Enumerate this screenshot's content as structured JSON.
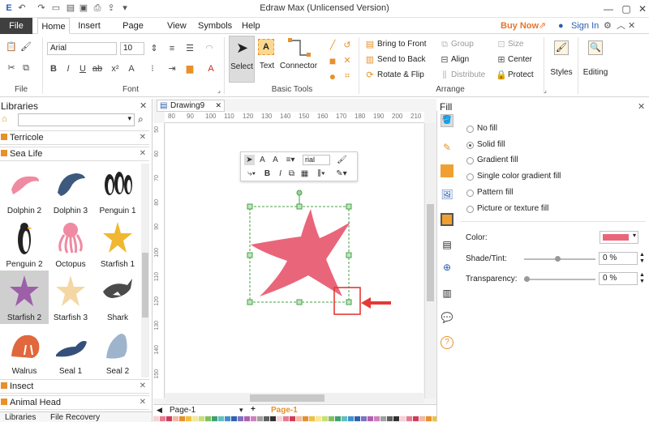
{
  "window": {
    "title": "Edraw Max (Unlicensed Version)"
  },
  "titlebar_right": {
    "buy_now": "Buy Now",
    "sign_in": "Sign In"
  },
  "tabs": [
    "File",
    "Home",
    "Insert",
    "Page Layout",
    "View",
    "Symbols",
    "Help"
  ],
  "ribbon": {
    "file_label": "File",
    "font_label": "Font",
    "font_name": "Arial",
    "font_size": "10",
    "basic_tools_label": "Basic Tools",
    "select": "Select",
    "text": "Text",
    "connector": "Connector",
    "bring_to_front": "Bring to Front",
    "send_to_back": "Send to Back",
    "rotate_flip": "Rotate & Flip",
    "group": "Group",
    "align": "Align",
    "distribute": "Distribute",
    "size": "Size",
    "center": "Center",
    "protect": "Protect",
    "arrange_label": "Arrange",
    "styles": "Styles",
    "editing": "Editing"
  },
  "libraries": {
    "title": "Libraries",
    "search_placeholder": "",
    "categories": [
      "Terricole",
      "Sea Life",
      "Insect",
      "Animal Head"
    ],
    "shapes": [
      "Dolphin 2",
      "Dolphin 3",
      "Penguin 1",
      "Penguin 2",
      "Octopus",
      "Starfish 1",
      "Starfish 2",
      "Starfish 3",
      "Shark",
      "Walrus",
      "Seal 1",
      "Seal 2"
    ],
    "bottom_tabs": [
      "Libraries",
      "File Recovery"
    ]
  },
  "document": {
    "tab": "Drawing9",
    "ruler_h": [
      "80",
      "90",
      "100",
      "110",
      "120",
      "130",
      "140",
      "150",
      "160",
      "170",
      "180",
      "190",
      "200",
      "210"
    ],
    "ruler_v": [
      "50",
      "60",
      "70",
      "80",
      "90",
      "100",
      "110",
      "120",
      "130",
      "140",
      "150"
    ],
    "page_tab": "Page-1",
    "page_tab_active": "Page-1"
  },
  "mini_toolbar": {
    "font": "rial"
  },
  "fill_panel": {
    "title": "Fill",
    "options": [
      "No fill",
      "Solid fill",
      "Gradient fill",
      "Single color gradient fill",
      "Pattern fill",
      "Picture or texture fill"
    ],
    "selected": "Solid fill",
    "color_label": "Color:",
    "shade_label": "Shade/Tint:",
    "shade_value": "0 %",
    "transparency_label": "Transparency:",
    "transparency_value": "0 %",
    "fill_color": "#e9667a"
  },
  "colors": {
    "accent": "#e8902a",
    "starfish": "#e9667a",
    "highlight": "#e53935",
    "selection": "#46a046"
  }
}
